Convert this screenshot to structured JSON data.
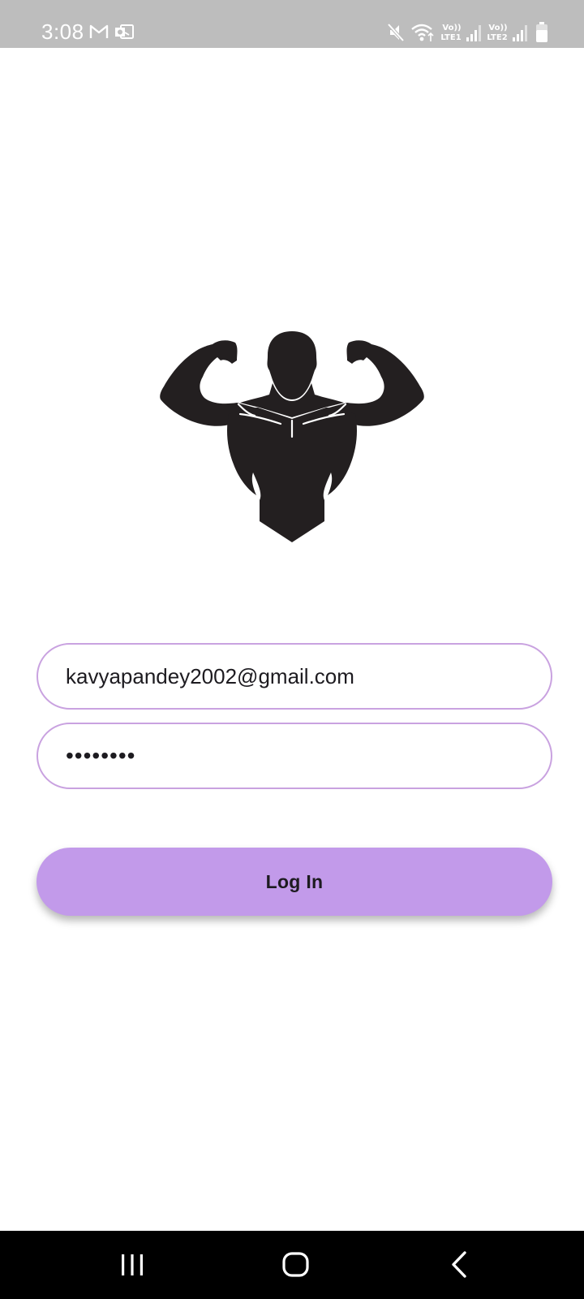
{
  "status_bar": {
    "time": "3:08",
    "sim1_label": "Vo))",
    "sim1_network": "LTE1",
    "sim2_label": "Vo))",
    "sim2_network": "LTE2",
    "icons": [
      "gmail-icon",
      "outlook-icon",
      "mute-icon",
      "wifi-icon",
      "signal-icon",
      "battery-icon"
    ]
  },
  "logo": {
    "icon": "bodybuilder-logo"
  },
  "login_form": {
    "email_value": "kavyapandey2002@gmail.com",
    "password_value": "••••••••",
    "login_label": "Log In"
  },
  "nav_bar": {
    "icons": [
      "recent-apps-icon",
      "home-icon",
      "back-icon"
    ]
  },
  "colors": {
    "accent": "#c29aea",
    "field_border": "#c9a2e0",
    "status_bar": "#bdbdbd",
    "nav_bar": "#000000",
    "logo": "#231f20"
  }
}
